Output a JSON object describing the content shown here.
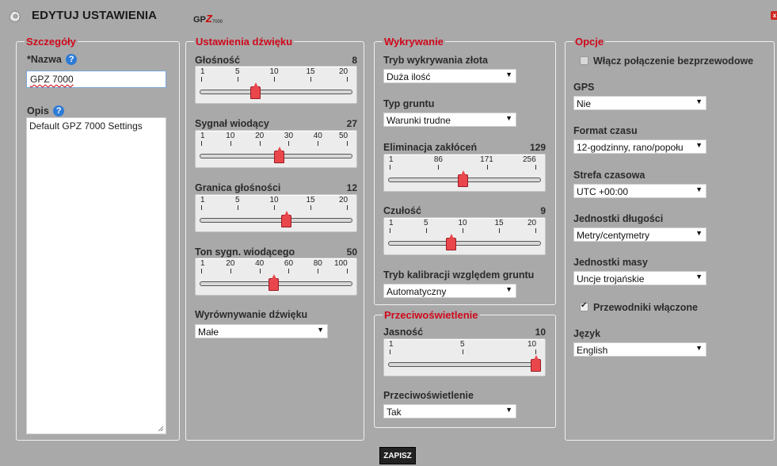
{
  "header": {
    "title": "EDYTUJ USTAWIENIA",
    "logo_prefix": "GP",
    "logo_z": "Z",
    "logo_num": "7000",
    "close_label": "x"
  },
  "details": {
    "legend": "Szczegóły",
    "name_label": "*Nazwa",
    "name_value": "GPZ 7000",
    "desc_label": "Opis",
    "desc_value": "Default GPZ 7000 Settings",
    "help_glyph": "?"
  },
  "sound": {
    "legend": "Ustawienia dźwięku",
    "sliders": [
      {
        "label": "Głośność",
        "value": "8",
        "ticks": [
          "1",
          "5",
          "10",
          "15",
          "20"
        ],
        "level": 0.368
      },
      {
        "label": "Sygnał wiodący",
        "value": "27",
        "ticks": [
          "1",
          "10",
          "20",
          "30",
          "40",
          "50"
        ],
        "level": 0.531
      },
      {
        "label": "Granica głośności",
        "value": "12",
        "ticks": [
          "1",
          "5",
          "10",
          "15",
          "20"
        ],
        "level": 0.579
      },
      {
        "label": "Ton sygn. wiodącego",
        "value": "50",
        "ticks": [
          "1",
          "20",
          "40",
          "60",
          "80",
          "100"
        ],
        "level": 0.495
      }
    ],
    "leveling_label": "Wyrównywanie dźwięku",
    "leveling_value": "Małe"
  },
  "detection": {
    "legend": "Wykrywanie",
    "gold_mode_label": "Tryb wykrywania złota",
    "gold_mode_value": "Duża ilość",
    "ground_type_label": "Typ gruntu",
    "ground_type_value": "Warunki trudne",
    "noise_label": "Eliminacja zakłóceń",
    "noise_value": "129",
    "noise_ticks": [
      "1",
      "86",
      "171",
      "256"
    ],
    "noise_level": 0.502,
    "sens_label": "Czułość",
    "sens_value": "9",
    "sens_ticks": [
      "1",
      "5",
      "10",
      "15",
      "20"
    ],
    "sens_level": 0.421,
    "ground_balance_label": "Tryb kalibracji względem gruntu",
    "ground_balance_value": "Automatyczny"
  },
  "backlight": {
    "legend": "Przeciwoświetlenie",
    "brightness_label": "Jasność",
    "brightness_value": "10",
    "brightness_ticks": [
      "1",
      "5",
      "10"
    ],
    "brightness_level": 1.0,
    "backlight_label": "Przeciwoświetlenie",
    "backlight_value": "Tak"
  },
  "options": {
    "legend": "Opcje",
    "wireless_label": "Włącz połączenie bezprzewodowe",
    "wireless_checked": false,
    "gps_label": "GPS",
    "gps_value": "Nie",
    "time_format_label": "Format czasu",
    "time_format_value": "12-godzinny, rano/popołu",
    "timezone_label": "Strefa czasowa",
    "timezone_value": "UTC +00:00",
    "length_label": "Jednostki długości",
    "length_value": "Metry/centymetry",
    "mass_label": "Jednostki masy",
    "mass_value": "Uncje trojańskie",
    "guides_label": "Przewodniki włączone",
    "guides_checked": true,
    "language_label": "Język",
    "language_value": "English"
  },
  "footer": {
    "save_label": "ZAPISZ"
  },
  "colors": {
    "legend_red": "#d0081b",
    "thumb_red": "#e9474c",
    "help_blue": "#2e7bd6"
  }
}
